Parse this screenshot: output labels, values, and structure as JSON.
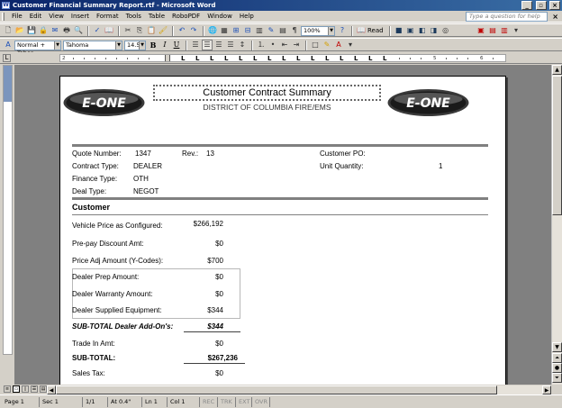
{
  "window": {
    "title": "Customer Financial Summary Report.rtf - Microsoft Word",
    "minimize": "_",
    "maximize": "▫",
    "close": "×"
  },
  "menu": {
    "items": [
      "File",
      "Edit",
      "View",
      "Insert",
      "Format",
      "Tools",
      "Table",
      "RoboPDF",
      "Window",
      "Help"
    ],
    "help_placeholder": "Type a question for help",
    "doc_close": "×"
  },
  "toolbar": {
    "zoom": "100%",
    "read_label": "Read",
    "style": "Normal + Tahor",
    "font": "Tahoma",
    "font_size": "14.5"
  },
  "document": {
    "title": "Customer Contract Summary",
    "subtitle": "DISTRICT OF COLUMBIA FIRE/EMS",
    "logo_text": "E-ONE",
    "info": {
      "quote_number_label": "Quote Number:",
      "quote_number": "1347",
      "rev_label": "Rev.:",
      "rev": "13",
      "customer_po_label": "Customer PO:",
      "customer_po": "",
      "contract_type_label": "Contract Type:",
      "contract_type": "DEALER",
      "unit_quantity_label": "Unit Quantity:",
      "unit_quantity": "1",
      "finance_type_label": "Finance Type:",
      "finance_type": "OTH",
      "deal_type_label": "Deal Type:",
      "deal_type": "NEGOT"
    },
    "customer_section": {
      "title": "Customer",
      "vehicle_price_label": "Vehicle Price as Configured:",
      "vehicle_price": "$266,192",
      "prepay_label": "Pre-pay Discount Amt:",
      "prepay": "$0",
      "price_adj_label": "Price Adj Amount (Y-Codes):",
      "price_adj": "$700",
      "dealer_prep_label": "Dealer Prep Amount:",
      "dealer_prep": "$0",
      "dealer_warranty_label": "Dealer Warranty Amount:",
      "dealer_warranty": "$0",
      "dealer_supplied_label": "Dealer Supplied Equipment:",
      "dealer_supplied": "$344",
      "subtotal_addons_label": "SUB-TOTAL Dealer Add-On's:",
      "subtotal_addons": "$344",
      "trade_in_label": "Trade In Amt:",
      "trade_in": "$0",
      "subtotal_label": "SUB-TOTAL:",
      "subtotal": "$267,236",
      "sales_tax_label": "Sales Tax:",
      "sales_tax": "$0"
    }
  },
  "statusbar": {
    "page": "Page 1",
    "sec": "Sec 1",
    "pages": "1/1",
    "at": "At 0.4\"",
    "ln": "Ln 1",
    "col": "Col 1",
    "rec": "REC",
    "trk": "TRK",
    "ext": "EXT",
    "ovr": "OVR"
  },
  "colors": {
    "titlebar": "#0a246a",
    "chrome": "#d4d0c8",
    "doc_bg": "#808080"
  }
}
